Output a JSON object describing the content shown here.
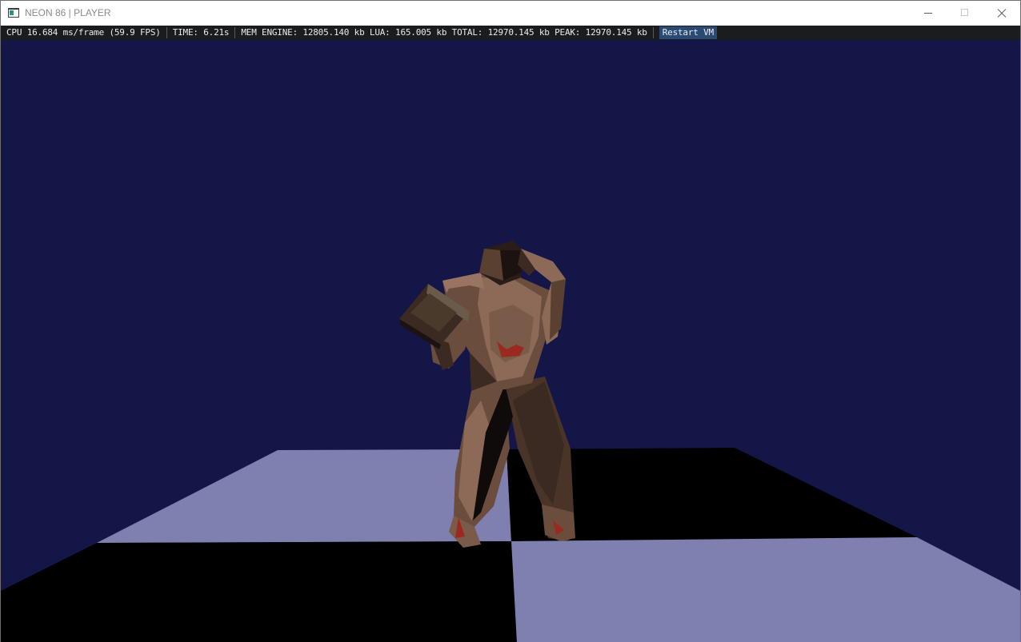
{
  "window": {
    "title": "NEON 86 | PLAYER",
    "icon": "app-window-icon",
    "controls": [
      "minimize-icon",
      "maximize-icon",
      "close-icon"
    ]
  },
  "stats": {
    "cpu": "CPU 16.684 ms/frame (59.9 FPS)",
    "time": "TIME: 6.21s",
    "mem": "MEM ENGINE: 12805.140 kb LUA: 165.005 kb TOTAL: 12970.145 kb PEAK: 12970.145 kb",
    "restart_label": "Restart VM"
  },
  "scene": {
    "sky_color": "#141647",
    "floor_light_color": "#7f7fb0",
    "floor_dark_color": "#000000",
    "character_colors": [
      "#3a2a22",
      "#6a4d3d",
      "#8d6a58",
      "#1c1210",
      "#9a2a1f"
    ]
  },
  "colors": {
    "statsbar_bg": "#1b1c1e",
    "restart_bg": "#2a4a72"
  }
}
